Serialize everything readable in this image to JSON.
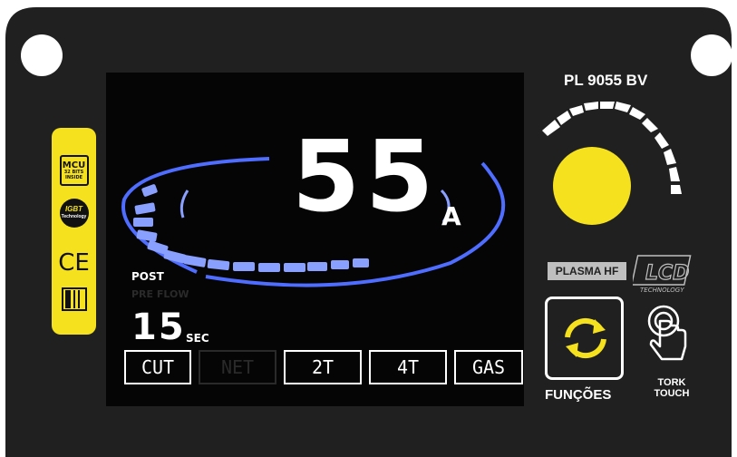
{
  "device": {
    "model": "PL 9055 BV",
    "body_color": "#202020",
    "accent_color": "#f5e11d"
  },
  "badges": {
    "mcu_line1": "MCU",
    "mcu_line2": "32 BITS",
    "mcu_line3": "INSIDE",
    "igbt_label": "IGBT",
    "igbt_sub": "Technology",
    "ce_mark": "CE"
  },
  "display": {
    "current_value": "55",
    "current_unit": "A",
    "post_label": "POST",
    "pre_label": "PRE FLOW",
    "seconds_value": "15",
    "seconds_unit": "SEC",
    "buttons": [
      {
        "label": "CUT",
        "active": true
      },
      {
        "label": "NET",
        "active": false
      },
      {
        "label": "2T",
        "active": true
      },
      {
        "label": "4T",
        "active": true
      },
      {
        "label": "GAS",
        "active": true
      }
    ],
    "arc_color": "#3a5cff"
  },
  "controls": {
    "plasma_label": "PLASMA HF",
    "lcd_tech_label": "LCD",
    "lcd_tech_sub": "TECHNOLOGY",
    "functions_label": "FUNÇÕES",
    "tork_line1": "TORK",
    "tork_line2": "TOUCH"
  }
}
